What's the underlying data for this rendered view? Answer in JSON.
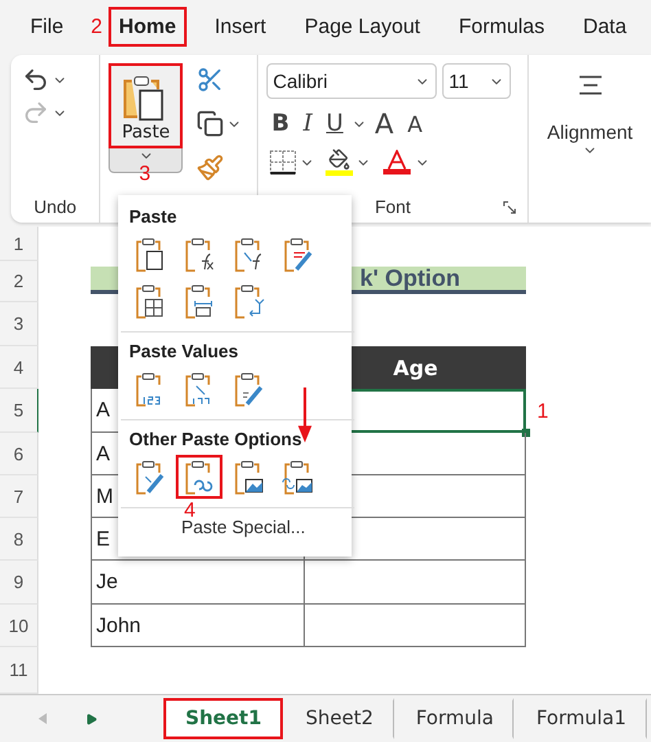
{
  "menu_tabs": [
    {
      "label": "File",
      "selected": false,
      "highlighted": false
    },
    {
      "label": "Home",
      "selected": true,
      "highlighted": true,
      "callout": "2"
    },
    {
      "label": "Insert",
      "selected": false,
      "highlighted": false
    },
    {
      "label": "Page Layout",
      "selected": false,
      "highlighted": false
    },
    {
      "label": "Formulas",
      "selected": false,
      "highlighted": false
    },
    {
      "label": "Data",
      "selected": false,
      "highlighted": false
    }
  ],
  "ribbon": {
    "undo_group": {
      "label": "Undo"
    },
    "clipboard_group": {
      "paste_button": {
        "label": "Paste",
        "highlighted": true,
        "callout": "3"
      }
    },
    "font_group": {
      "label": "Font",
      "font_name": "Calibri",
      "font_size": "11",
      "bold": "B",
      "italic": "I",
      "underline": "U",
      "grow": "A",
      "shrink": "A"
    },
    "alignment_group": {
      "label": "Alignment"
    }
  },
  "sheet": {
    "row_numbers": [
      "1",
      "2",
      "3",
      "4",
      "5",
      "6",
      "7",
      "8",
      "9",
      "10",
      "11"
    ],
    "title": "k' Option",
    "header": {
      "column_2": "Age"
    },
    "rows": [
      {
        "name": "A",
        "age_selected": true,
        "callout": "1"
      },
      {
        "name": "A",
        "age_selected": false
      },
      {
        "name": "M",
        "age_selected": false
      },
      {
        "name": "E",
        "age_selected": false
      },
      {
        "name": "Je",
        "age_selected": false
      },
      {
        "name": "John",
        "age_selected": false
      }
    ]
  },
  "paste_menu": {
    "sections": [
      {
        "title": "Paste",
        "options": [
          {
            "highlighted": false
          },
          {
            "highlighted": false
          },
          {
            "highlighted": false
          },
          {
            "highlighted": false
          },
          {
            "highlighted": false
          },
          {
            "highlighted": false
          },
          {
            "highlighted": false
          }
        ]
      },
      {
        "title": "Paste Values",
        "options": [
          {
            "highlighted": false
          },
          {
            "highlighted": false
          },
          {
            "highlighted": false
          }
        ]
      },
      {
        "title": "Other Paste Options",
        "options": [
          {
            "highlighted": false
          },
          {
            "highlighted": true,
            "callout": "4"
          },
          {
            "highlighted": false
          },
          {
            "highlighted": false
          }
        ]
      }
    ],
    "paste_special": "Paste Special..."
  },
  "sheet_tabs": [
    {
      "label": "Sheet1",
      "selected": true,
      "highlighted": true
    },
    {
      "label": "Sheet2",
      "selected": false,
      "highlighted": false
    },
    {
      "label": "Formula",
      "selected": false,
      "highlighted": false
    },
    {
      "label": "Formula1",
      "selected": false,
      "highlighted": false
    }
  ]
}
